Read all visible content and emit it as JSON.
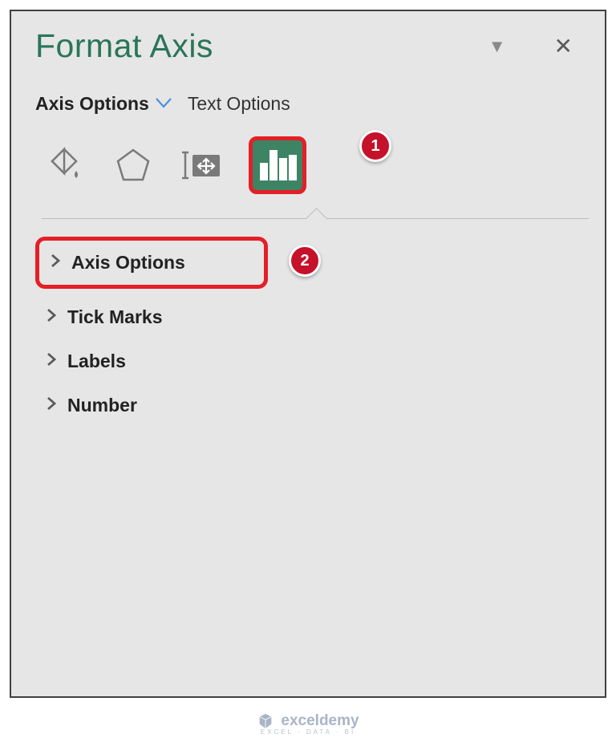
{
  "pane": {
    "title": "Format Axis"
  },
  "tabs": {
    "axisOptions": "Axis Options",
    "textOptions": "Text Options"
  },
  "callouts": {
    "one": "1",
    "two": "2"
  },
  "sections": {
    "axisOptions": "Axis Options",
    "tickMarks": "Tick Marks",
    "labels": "Labels",
    "number": "Number"
  },
  "watermark": {
    "brand": "exceldemy",
    "tagline": "EXCEL · DATA · BI"
  }
}
